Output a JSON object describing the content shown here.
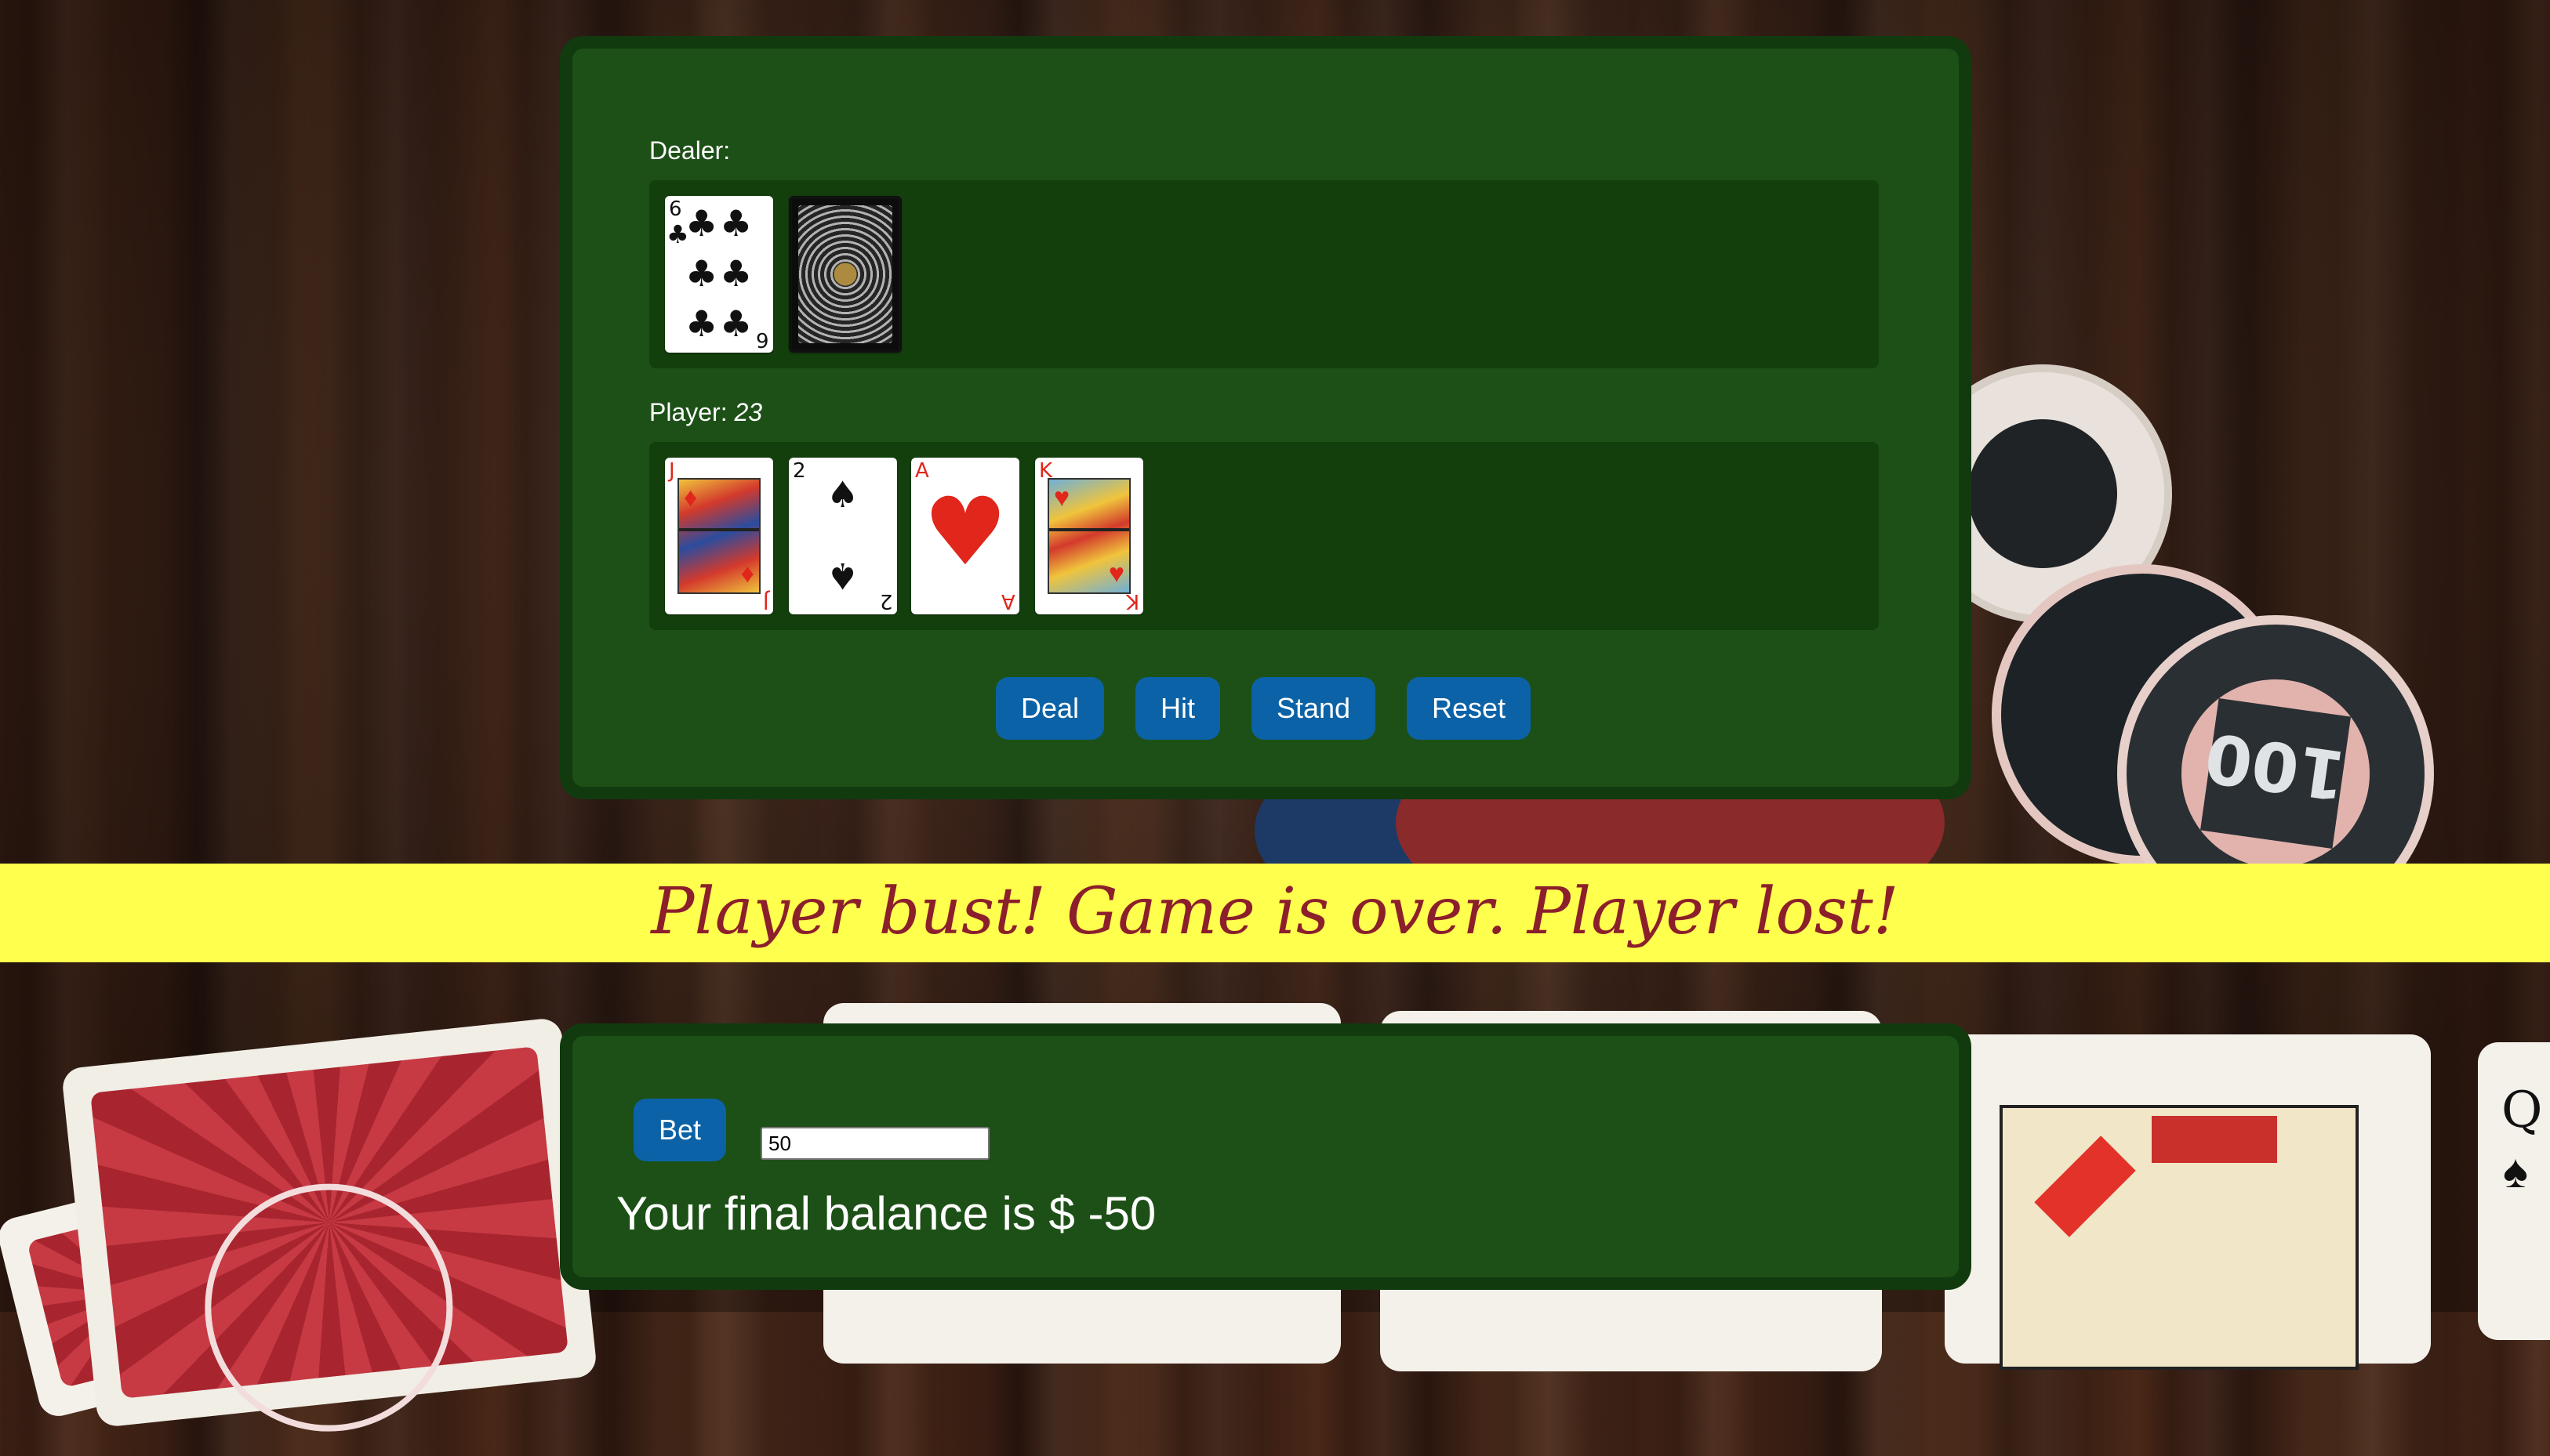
{
  "game": {
    "dealer_label": "Dealer:",
    "player_label": "Player:",
    "player_score": "23",
    "dealer_cards": [
      {
        "rank": "6",
        "suit": "♣",
        "color": "black",
        "face_down": false
      },
      {
        "rank": "",
        "suit": "",
        "color": "",
        "face_down": true
      }
    ],
    "player_cards": [
      {
        "rank": "J",
        "suit": "♦",
        "color": "red"
      },
      {
        "rank": "2",
        "suit": "♠",
        "color": "black"
      },
      {
        "rank": "A",
        "suit": "♥",
        "color": "red"
      },
      {
        "rank": "K",
        "suit": "♥",
        "color": "red"
      }
    ]
  },
  "buttons": {
    "deal": "Deal",
    "hit": "Hit",
    "stand": "Stand",
    "reset": "Reset"
  },
  "banner": {
    "message": "Player bust! Game is over. Player lost!"
  },
  "betting": {
    "bet_label": "Bet",
    "bet_value": "50",
    "balance_text": "Your final balance is $ -50"
  },
  "background": {
    "chip_value": "100"
  },
  "colors": {
    "table_green": "#1d5017",
    "hand_area": "#133f0d",
    "button_blue": "#0b62a6",
    "banner_yellow": "#ffff4d",
    "banner_text": "#8b1f2b"
  }
}
